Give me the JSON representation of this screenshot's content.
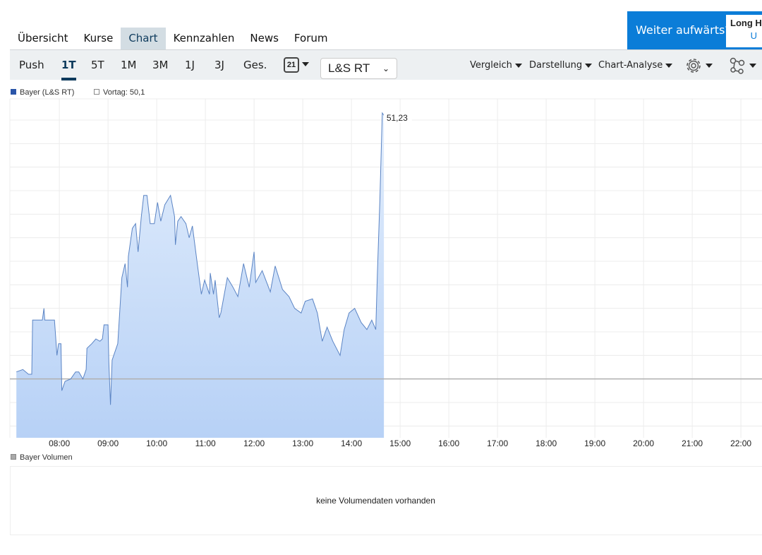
{
  "nav": {
    "tabs": [
      {
        "label": "Übersicht"
      },
      {
        "label": "Kurse"
      },
      {
        "label": "Chart",
        "active": true
      },
      {
        "label": "Kennzahlen"
      },
      {
        "label": "News"
      },
      {
        "label": "Forum"
      }
    ]
  },
  "banner": {
    "question": "Weiter aufwärts?",
    "box_title": "Long H",
    "box_sub": "U"
  },
  "toolbar": {
    "ranges": [
      "Push",
      "1T",
      "5T",
      "1M",
      "3M",
      "1J",
      "3J",
      "Ges."
    ],
    "active_range": "1T",
    "calendar_day": "21",
    "exchange": "L&S RT",
    "menus": [
      "Vergleich",
      "Darstellung",
      "Chart-Analyse"
    ]
  },
  "colors": {
    "accent": "#0d3a5c",
    "banner": "#0b7dd8",
    "line": "#5b84c4",
    "fill_top": "#e3eefc",
    "fill_bottom": "#b7d1f6"
  },
  "chart_data": {
    "type": "area",
    "legend": [
      {
        "label": "Bayer (L&S RT)",
        "color": "#2a55a8"
      },
      {
        "label": "Vortag: 50,1",
        "color": "#ffffff"
      }
    ],
    "previous_close": 50.1,
    "last_label": "51,23",
    "xlabel": "",
    "ylabel": "",
    "x_unit": "minutes since midnight",
    "xlim": [
      419,
      1346
    ],
    "ylim": [
      49.85,
      51.29
    ],
    "x_ticks": [
      "08:00",
      "09:00",
      "10:00",
      "11:00",
      "12:00",
      "13:00",
      "14:00",
      "15:00",
      "16:00",
      "17:00",
      "18:00",
      "19:00",
      "20:00",
      "21:00",
      "22:00"
    ],
    "grid": true,
    "points": [
      [
        427,
        50.13
      ],
      [
        435,
        50.14
      ],
      [
        442,
        50.12
      ],
      [
        446,
        50.12
      ],
      [
        447,
        50.35
      ],
      [
        459,
        50.35
      ],
      [
        461,
        50.4
      ],
      [
        462,
        50.35
      ],
      [
        474,
        50.35
      ],
      [
        475,
        50.3
      ],
      [
        477,
        50.2
      ],
      [
        479,
        50.25
      ],
      [
        482,
        50.25
      ],
      [
        483,
        50.05
      ],
      [
        487,
        50.09
      ],
      [
        494,
        50.1
      ],
      [
        500,
        50.13
      ],
      [
        504,
        50.13
      ],
      [
        509,
        50.1
      ],
      [
        513,
        50.14
      ],
      [
        514,
        50.23
      ],
      [
        520,
        50.25
      ],
      [
        525,
        50.27
      ],
      [
        530,
        50.26
      ],
      [
        533,
        50.27
      ],
      [
        535,
        50.33
      ],
      [
        540,
        50.33
      ],
      [
        541,
        50.17
      ],
      [
        543,
        49.99
      ],
      [
        545,
        50.18
      ],
      [
        552,
        50.25
      ],
      [
        557,
        50.53
      ],
      [
        561,
        50.59
      ],
      [
        564,
        50.49
      ],
      [
        565,
        50.62
      ],
      [
        570,
        50.74
      ],
      [
        574,
        50.76
      ],
      [
        577,
        50.64
      ],
      [
        581,
        50.79
      ],
      [
        584,
        50.88
      ],
      [
        588,
        50.88
      ],
      [
        592,
        50.76
      ],
      [
        597,
        50.76
      ],
      [
        601,
        50.85
      ],
      [
        605,
        50.77
      ],
      [
        610,
        50.84
      ],
      [
        617,
        50.88
      ],
      [
        622,
        50.79
      ],
      [
        623,
        50.67
      ],
      [
        626,
        50.77
      ],
      [
        630,
        50.79
      ],
      [
        636,
        50.76
      ],
      [
        640,
        50.7
      ],
      [
        644,
        50.75
      ],
      [
        650,
        50.59
      ],
      [
        655,
        50.46
      ],
      [
        659,
        50.52
      ],
      [
        665,
        50.46
      ],
      [
        666,
        50.55
      ],
      [
        670,
        50.46
      ],
      [
        672,
        50.52
      ],
      [
        677,
        50.36
      ],
      [
        679,
        50.38
      ],
      [
        687,
        50.53
      ],
      [
        694,
        50.49
      ],
      [
        700,
        50.45
      ],
      [
        707,
        50.59
      ],
      [
        714,
        50.49
      ],
      [
        720,
        50.64
      ],
      [
        722,
        50.51
      ],
      [
        730,
        50.56
      ],
      [
        740,
        50.47
      ],
      [
        746,
        50.58
      ],
      [
        755,
        50.48
      ],
      [
        763,
        50.45
      ],
      [
        770,
        50.4
      ],
      [
        778,
        50.38
      ],
      [
        783,
        50.43
      ],
      [
        792,
        50.44
      ],
      [
        798,
        50.38
      ],
      [
        804,
        50.26
      ],
      [
        810,
        50.32
      ],
      [
        817,
        50.26
      ],
      [
        826,
        50.2
      ],
      [
        831,
        50.31
      ],
      [
        837,
        50.38
      ],
      [
        844,
        50.4
      ],
      [
        852,
        50.34
      ],
      [
        859,
        50.31
      ],
      [
        865,
        50.35
      ],
      [
        870,
        50.31
      ],
      [
        872,
        50.55
      ],
      [
        875,
        50.86
      ],
      [
        878,
        51.23
      ],
      [
        880,
        51.22
      ]
    ]
  },
  "volume": {
    "legend": "Bayer Volumen",
    "message": "keine Volumendaten vorhanden"
  }
}
